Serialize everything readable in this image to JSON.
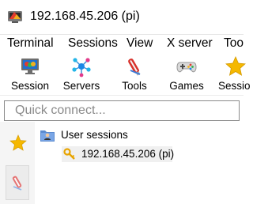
{
  "window": {
    "title": "192.168.45.206 (pi)",
    "app_icon": "mobaxterm-icon"
  },
  "menu": {
    "items": [
      {
        "label": "Terminal"
      },
      {
        "label": "Sessions"
      },
      {
        "label": "View"
      },
      {
        "label": "X server"
      },
      {
        "label": "Too"
      }
    ]
  },
  "toolbar": {
    "items": [
      {
        "label": "Session",
        "icon": "monitor-session-icon"
      },
      {
        "label": "Servers",
        "icon": "servers-network-icon"
      },
      {
        "label": "Tools",
        "icon": "tools-knife-icon"
      },
      {
        "label": "Games",
        "icon": "gamepad-icon"
      },
      {
        "label": "Sessio",
        "icon": "star-icon"
      }
    ]
  },
  "quick_connect": {
    "placeholder": "Quick connect...",
    "value": ""
  },
  "sidebar": {
    "icons": [
      "star-icon",
      "tools-knife-icon"
    ]
  },
  "tree": {
    "folder_label": "User sessions",
    "session_label": "192.168.45.206 (pi)"
  },
  "colors": {
    "star": "#f5b800",
    "folder": "#5b8bd0",
    "selection": "#f0f0f0"
  }
}
